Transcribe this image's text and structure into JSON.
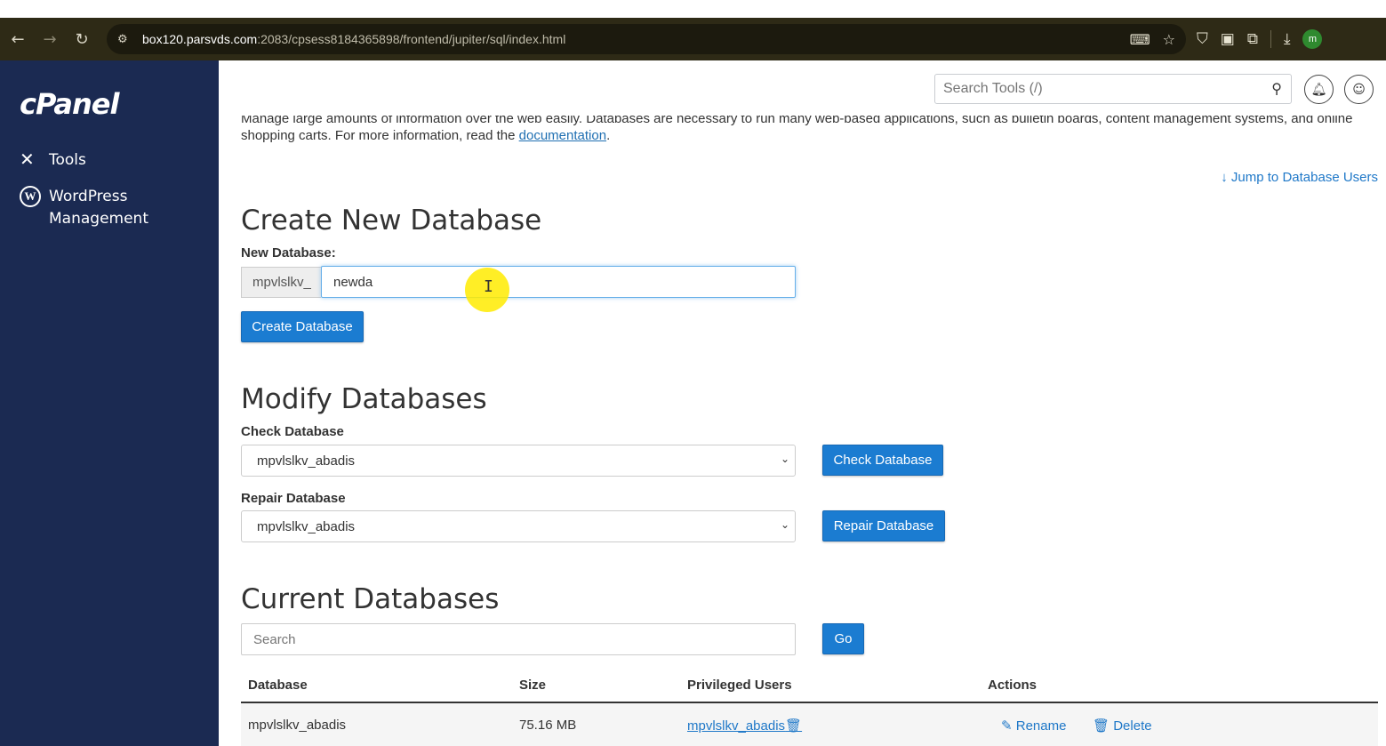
{
  "browser": {
    "url_host": "box120.parsvds.com",
    "url_path": ":2083/cpsess8184365898/frontend/jupiter/sql/index.html",
    "profile_initial": "m"
  },
  "sidebar": {
    "logo": "cPanel",
    "items": [
      {
        "label": "Tools"
      },
      {
        "label": "WordPress Management"
      }
    ]
  },
  "header": {
    "search_placeholder": "Search Tools (/)"
  },
  "intro": {
    "line1": "Manage large amounts of information over the web easily. Databases are necessary to run many web-based applications, such as bulletin boards, content management systems, and online",
    "line2_pre": "shopping carts. For more information, read the ",
    "link": "documentation",
    "line2_post": "."
  },
  "jump_link": "Jump to Database Users",
  "create": {
    "title": "Create New Database",
    "label": "New Database:",
    "prefix": "mpvlslkv_",
    "value": "newda",
    "button": "Create Database"
  },
  "modify": {
    "title": "Modify Databases",
    "check_label": "Check Database",
    "check_selected": "mpvlslkv_abadis",
    "check_button": "Check Database",
    "repair_label": "Repair Database",
    "repair_selected": "mpvlslkv_abadis",
    "repair_button": "Repair Database"
  },
  "current": {
    "title": "Current Databases",
    "search_placeholder": "Search",
    "go_button": "Go",
    "columns": [
      "Database",
      "Size",
      "Privileged Users",
      "Actions"
    ],
    "rows": [
      {
        "database": "mpvlslkv_abadis",
        "size": "75.16 MB",
        "users": "mpvlslkv_abadis",
        "rename": "Rename",
        "delete": "Delete"
      }
    ]
  },
  "colors": {
    "sidebar": "#1b2a52",
    "button": "#1b7cd1",
    "link": "#1f78c8",
    "browser_bar": "#2e2a16"
  }
}
